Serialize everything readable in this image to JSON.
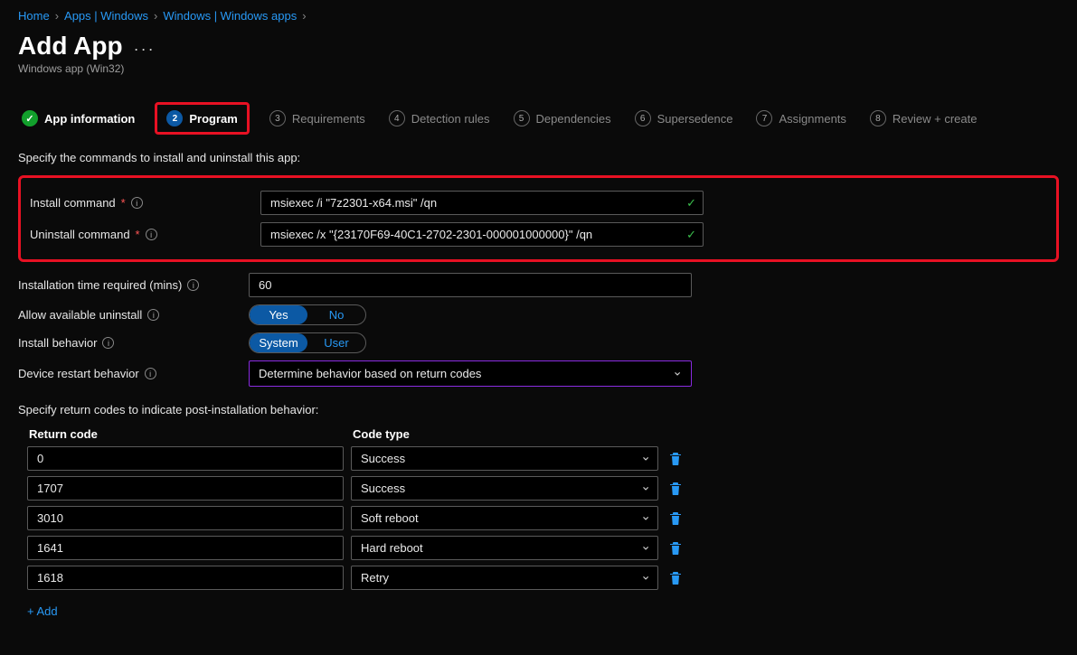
{
  "breadcrumb": [
    {
      "label": "Home"
    },
    {
      "label": "Apps | Windows"
    },
    {
      "label": "Windows | Windows apps"
    }
  ],
  "page": {
    "title": "Add App",
    "subtitle": "Windows app (Win32)"
  },
  "steps": [
    {
      "label": "App information",
      "state": "done"
    },
    {
      "label": "Program",
      "state": "current",
      "num": "2"
    },
    {
      "label": "Requirements",
      "num": "3"
    },
    {
      "label": "Detection rules",
      "num": "4"
    },
    {
      "label": "Dependencies",
      "num": "5"
    },
    {
      "label": "Supersedence",
      "num": "6"
    },
    {
      "label": "Assignments",
      "num": "7"
    },
    {
      "label": "Review + create",
      "num": "8"
    }
  ],
  "section1_desc": "Specify the commands to install and uninstall this app:",
  "fields": {
    "install_command": {
      "label": "Install command",
      "value": "msiexec /i \"7z2301-x64.msi\" /qn",
      "required": true,
      "valid": true
    },
    "uninstall_command": {
      "label": "Uninstall command",
      "value": "msiexec /x \"{23170F69-40C1-2702-2301-000001000000}\" /qn",
      "required": true,
      "valid": true
    },
    "install_time": {
      "label": "Installation time required (mins)",
      "value": "60"
    },
    "allow_uninstall": {
      "label": "Allow available uninstall",
      "options": [
        "Yes",
        "No"
      ],
      "selected": "Yes"
    },
    "install_behavior": {
      "label": "Install behavior",
      "options": [
        "System",
        "User"
      ],
      "selected": "System"
    },
    "restart_behavior": {
      "label": "Device restart behavior",
      "value": "Determine behavior based on return codes"
    }
  },
  "section2_desc": "Specify return codes to indicate post-installation behavior:",
  "rc_header": {
    "code": "Return code",
    "type": "Code type"
  },
  "return_codes": [
    {
      "code": "0",
      "type": "Success"
    },
    {
      "code": "1707",
      "type": "Success"
    },
    {
      "code": "3010",
      "type": "Soft reboot"
    },
    {
      "code": "1641",
      "type": "Hard reboot"
    },
    {
      "code": "1618",
      "type": "Retry"
    }
  ],
  "add_link": "+ Add"
}
